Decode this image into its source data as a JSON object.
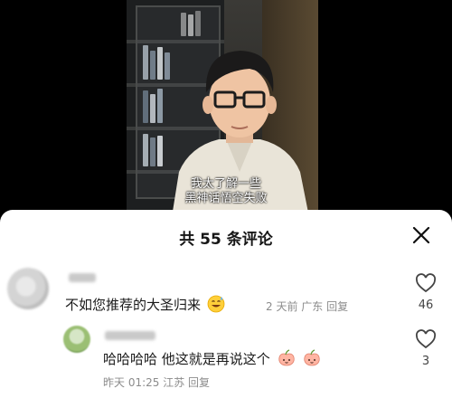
{
  "video": {
    "subtitle_line1": "我太了解一些",
    "subtitle_line2": "黑神话悟空失败"
  },
  "comments_panel": {
    "title": "共 55 条评论",
    "close_icon": "close-icon",
    "comments": [
      {
        "text": "不如您推荐的大圣归来",
        "emoji": "grinning-sweat-emoji",
        "meta": "2 天前 广东 回复",
        "likes": "46"
      },
      {
        "text": "哈哈哈哈 他这就是再说这个",
        "emoji": "peach-face-emoji",
        "meta": "昨天 01:25 江苏 回复",
        "likes": "3"
      }
    ]
  },
  "colors": {
    "sheet_bg": "#ffffff",
    "text_primary": "#1a1a1a",
    "text_meta": "#8c8c8c"
  }
}
